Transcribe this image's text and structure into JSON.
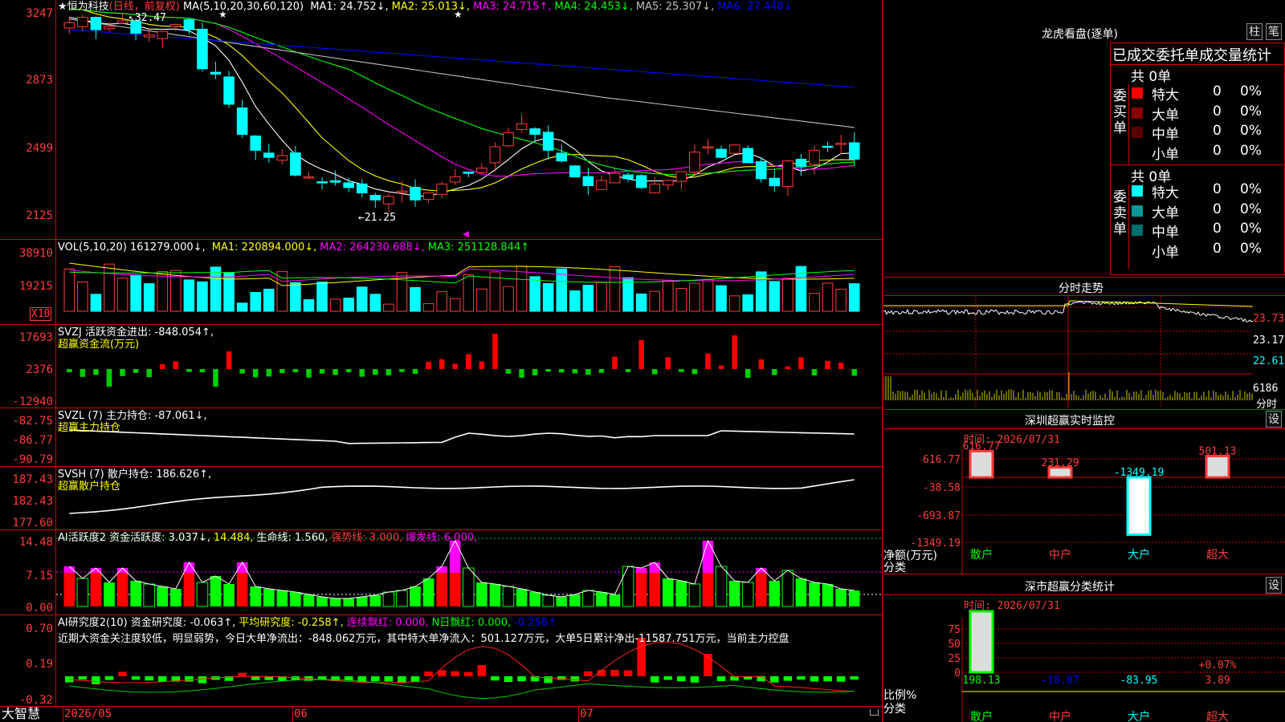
{
  "app": {
    "brand": "大智慧",
    "stock_title": "★恒为科技",
    "chart_mode": "(日线，前复权)",
    "dates": [
      "2026/05",
      "06",
      "07"
    ]
  },
  "main_panel": {
    "ma_params": "MA(5,10,20,30,60,120)",
    "ma_items": [
      {
        "label": "MA1:",
        "value": "24.752↓,",
        "color": "#ffffff"
      },
      {
        "label": "MA2:",
        "value": "25.013↓,",
        "color": "#ffff00"
      },
      {
        "label": "MA3:",
        "value": "24.715↑,",
        "color": "#ff00ff"
      },
      {
        "label": "MA4:",
        "value": "24.453↓,",
        "color": "#00ff00"
      },
      {
        "label": "MA5:",
        "value": "25.307↓,",
        "color": "#c0c0c0"
      },
      {
        "label": "MA6:",
        "value": "27.448↓",
        "color": "#0000ff"
      }
    ],
    "y_ticks": [
      "3247",
      "2873",
      "2499",
      "2125"
    ],
    "high_label": "32.47",
    "low_label": "21.25"
  },
  "vol_panel": {
    "header": "VOL(5,10,20) 161279.000↓,",
    "items": [
      {
        "text": "MA1: 220894.000↓,",
        "color": "#ffff00"
      },
      {
        "text": "MA2: 264230.688↓,",
        "color": "#ff00ff"
      },
      {
        "text": "MA3: 251128.844↑",
        "color": "#00ff00"
      }
    ],
    "y_ticks": [
      "38910",
      "19215"
    ],
    "unit": "X10"
  },
  "svzj_panel": {
    "header": "SVZJ  活跃资金进出: -848.054↑,",
    "subtitle": "超赢资金流(万元)",
    "y_ticks": [
      "17693",
      "2376",
      "-12940"
    ]
  },
  "svzl_panel": {
    "header": "SVZL (7) 主力持仓: -87.061↓,",
    "subtitle": "超赢主力持仓",
    "y_ticks": [
      "-82.75",
      "-86.77",
      "-90.79"
    ]
  },
  "svsh_panel": {
    "header": "SVSH (7) 散户持仓: 186.626↑,",
    "subtitle": "超赢散户持仓",
    "y_ticks": [
      "187.43",
      "182.43",
      "177.60"
    ]
  },
  "ai_active_panel": {
    "header": "AI活跃度2 资金活跃度: 3.037↓,",
    "items": [
      {
        "text": "14.484,",
        "color": "#ffff00"
      },
      {
        "text": "生命线: 1.560,",
        "color": "#ffffff"
      },
      {
        "text": "强势线: 3.000,",
        "color": "#ff3c3c"
      },
      {
        "text": "爆发线: 6.000,",
        "color": "#ff00ff"
      }
    ],
    "y_ticks": [
      "14.48",
      "7.15",
      "0.00"
    ]
  },
  "ai_research_panel": {
    "header": "AI研究度2(10) 资金研究度: -0.063↑,",
    "items": [
      {
        "text": "平均研究度: -0.258↑,",
        "color": "#ffff00"
      },
      {
        "text": "连续飘红: 0.000,",
        "color": "#ff00ff"
      },
      {
        "text": "N日飘红: 0.000,",
        "color": "#00ff00"
      },
      {
        "text": "-0.258↑",
        "color": "#0000ff"
      }
    ],
    "comment": "近期大资金关注度较低，明显弱势，今日大单净流出：-848.062万元，其中特大单净流入：501.127万元，大单5日累计净出-11587.751万元，当前主力控盘",
    "y_ticks": [
      "0.70",
      "0.19",
      "-0.32"
    ]
  },
  "right_panel": {
    "lhb_title": "龙虎看盘(逐单)",
    "btn_zhu": "柱",
    "btn_bi": "笔",
    "stats_title": "已成交委托单成交量统计",
    "buy_label": "委买单",
    "sell_label": "委卖单",
    "buy_total": "共 0单",
    "sell_total": "共 0单",
    "buy_rows": [
      {
        "label": "特大",
        "count": "0",
        "pct": "0%",
        "color": "#ff0000"
      },
      {
        "label": "大单",
        "count": "0",
        "pct": "0%",
        "color": "#8b0000"
      },
      {
        "label": "中单",
        "count": "0",
        "pct": "0%",
        "color": "#5a0000"
      },
      {
        "label": "小单",
        "count": "0",
        "pct": "0%",
        "color": "#000000"
      }
    ],
    "sell_rows": [
      {
        "label": "特大",
        "count": "0",
        "pct": "0%",
        "color": "#00ffff"
      },
      {
        "label": "大单",
        "count": "0",
        "pct": "0%",
        "color": "#009999"
      },
      {
        "label": "中单",
        "count": "0",
        "pct": "0%",
        "color": "#006f6f"
      },
      {
        "label": "小单",
        "count": "0",
        "pct": "0%",
        "color": "#000000"
      }
    ],
    "intraday_title": "分时走势",
    "intraday_ticks": [
      "23.73",
      "23.17",
      "22.61"
    ],
    "intraday_vol_tick": "6186",
    "intraday_vol_unit": "分时",
    "sz_monitor_title": "深圳超赢实时监控",
    "sz_monitor_btn": "设",
    "sz_monitor_time": "时间: 2026/07/31",
    "sz_monitor_ticks": [
      "616.77",
      "-38.58",
      "-693.87",
      "-1349.19"
    ],
    "sz_monitor_ylabel1": "净额(万元)",
    "sz_monitor_ylabel2": "分类",
    "sz_monitor_bars": [
      {
        "category": "散户",
        "value": 616.77,
        "label": "616.77",
        "label_color": "#ff3c3c"
      },
      {
        "category": "中户",
        "value": 231.29,
        "label": "231.29",
        "label_color": "#ff3c3c"
      },
      {
        "category": "大户",
        "value": -1349.19,
        "label": "-1349.19",
        "label_color": "#00ffff"
      },
      {
        "category": "超大",
        "value": 501.13,
        "label": "501.13",
        "label_color": "#ff3c3c"
      }
    ],
    "classify_title": "深市超赢分类统计",
    "classify_btn": "设",
    "classify_time": "时间: 2026/07/31",
    "classify_ticks": [
      "75",
      "50",
      "25",
      "0"
    ],
    "classify_ylabel1": "比例%",
    "classify_ylabel2": "分类",
    "classify_bars": [
      {
        "category": "散户",
        "label": "198.13",
        "label_color": "#00ff00",
        "pct": 100
      },
      {
        "category": "中户",
        "label": "-18.07",
        "label_color": "#0000ff",
        "pct": 0
      },
      {
        "category": "大户",
        "label": "-83.95",
        "label_color": "#00ffff",
        "pct": 0
      },
      {
        "category": "超大",
        "label": "3.89",
        "label_color": "#ff3c3c",
        "pct": 0,
        "top_label": "+0.07%"
      }
    ],
    "category_colors": {
      "散户": "#00ff00",
      "中户": "#ff3c3c",
      "大户": "#00ffff",
      "超大": "#ff3c3c"
    }
  },
  "colors": {
    "up": "#ff3c3c",
    "down": "#00ffff",
    "grid": "#c00000"
  }
}
